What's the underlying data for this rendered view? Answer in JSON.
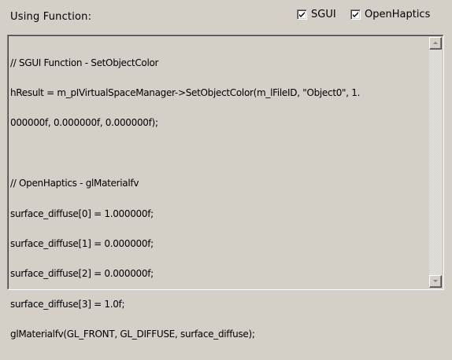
{
  "header": {
    "title": "Using Function:"
  },
  "options": {
    "sgui": {
      "label": "SGUI",
      "checked": true
    },
    "openhaptics": {
      "label": "OpenHaptics",
      "checked": true
    }
  },
  "code": {
    "lines": [
      "// SGUI Function - SetObjectColor",
      "hResult = m_pIVirtualSpaceManager->SetObjectColor(m_lFileID, \"Object0\", 1.",
      "000000f, 0.000000f, 0.000000f);",
      "",
      "// OpenHaptics - glMaterialfv",
      "surface_diffuse[0] = 1.000000f;",
      "surface_diffuse[1] = 0.000000f;",
      "surface_diffuse[2] = 0.000000f;",
      "surface_diffuse[3] = 1.0f;",
      "glMaterialfv(GL_FRONT, GL_DIFFUSE, surface_diffuse);"
    ]
  }
}
